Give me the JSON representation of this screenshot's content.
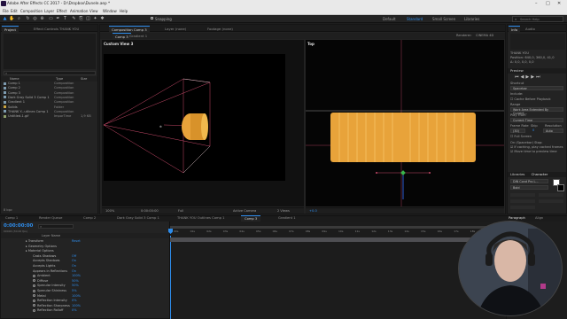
{
  "window": {
    "title": "Adobe After Effects CC 2017 - D:\\Dropbox\\Dunele.aep *"
  },
  "menu": [
    "File",
    "Edit",
    "Composition",
    "Layer",
    "Effect",
    "Animation",
    "View",
    "Window",
    "Help"
  ],
  "toolbar": {
    "snapping_label": "Snapping",
    "workspaces": [
      "Default",
      "Standard",
      "Small Screen",
      "Libraries"
    ],
    "active_workspace": "Standard",
    "search_placeholder": "Search Help"
  },
  "project": {
    "tabs": [
      "Project",
      "Effect Controls THANK YOU"
    ],
    "columns": {
      "name": "Name",
      "type": "Type",
      "size": "Size"
    },
    "items": [
      {
        "name": "Comp 1",
        "type": "Composition",
        "size": "",
        "kind": "comp"
      },
      {
        "name": "Comp 2",
        "type": "Composition",
        "size": "",
        "kind": "comp"
      },
      {
        "name": "Comp 3",
        "type": "Composition",
        "size": "",
        "kind": "comp"
      },
      {
        "name": "Dark Gray Solid 3 Comp 1",
        "type": "Composition",
        "size": "",
        "kind": "comp"
      },
      {
        "name": "Gradient 1",
        "type": "Composition",
        "size": "",
        "kind": "comp"
      },
      {
        "name": "Solids",
        "type": "Folder",
        "size": "",
        "kind": "folder"
      },
      {
        "name": "THANK Y...utlines Comp 1",
        "type": "Composition",
        "size": "",
        "kind": "comp"
      },
      {
        "name": "Untitled-1.gif",
        "type": "ImporTime",
        "size": "1,9 KB",
        "kind": "file"
      }
    ],
    "footer": "8 bpc"
  },
  "composition_panel": {
    "tabs": [
      "Composition Comp 3",
      "Layer (none)",
      "Footage (none)"
    ],
    "subtabs": [
      "Comp 3",
      "Gradient 1"
    ],
    "left_view_label": "Custom View 3",
    "right_view_label": "Top",
    "renderer_label": "Renderer:",
    "renderer_value": "CINEMA 4D",
    "footer": {
      "zoom": "100%",
      "timecode": "0:00:00:00",
      "resolution": "Full",
      "camera": "Active Camera",
      "views": "2 Views",
      "offset": "+0.0"
    }
  },
  "info_panel": {
    "tabs": [
      "Info",
      "Audio"
    ],
    "lines": [
      "THANK YOU",
      "Position: 640,0, 360,0, 41,0",
      "Δ: 0,0, 0,0, 0,0"
    ]
  },
  "preview_panel": {
    "title": "Preview",
    "shortcut_label": "Shortcut",
    "shortcut_value": "Spacebar",
    "include_label": "Include:",
    "cache_label": "Cache Before Playback",
    "range_label": "Range",
    "range_value": "Work Area Extended By Current...",
    "play_from_label": "Play From",
    "play_from_value": "Current Time",
    "frame_rate_label": "Frame Rate",
    "skip_label": "Skip",
    "resolution_label": "Resolution",
    "frame_rate_value": "(30)",
    "skip_value": "0",
    "resolution_value": "Auto",
    "full_screen_label": "Full Screen",
    "on_stop_label": "On (Spacebar) Stop:",
    "if_caching_label": "If caching, play cached frames",
    "move_time_label": "Move time to preview time"
  },
  "libraries_panel": {
    "tabs": [
      "Libraries",
      "Character"
    ],
    "font": "DIN Cond Pro L...",
    "style": "Bold"
  },
  "paragraph_panel": {
    "tabs": [
      "Paragraph",
      "Align"
    ]
  },
  "timeline": {
    "tabs": [
      "Comp 1",
      "Render Queue",
      "Comp 2",
      "Dark Gray Solid 3 Comp 1",
      "THANK YOU Outlines Comp 1",
      "Comp 3",
      "Gradient 1"
    ],
    "active_tab": "Comp 3",
    "timecode": "0:00:00:00",
    "fps": "00000 (30.00 fps)",
    "search_placeholder": "",
    "column_header": "Layer Name",
    "ruler": [
      "00s",
      "01s",
      "02s",
      "03s",
      "04s",
      "05s",
      "06s",
      "07s",
      "08s",
      "09s",
      "10s",
      "11s",
      "12s",
      "13s",
      "14s",
      "15s",
      "16s",
      "17s",
      "18s",
      "19s"
    ],
    "properties": [
      {
        "name": "Transform",
        "value": "Reset",
        "indent": 0,
        "twirl": true
      },
      {
        "name": "Geometry Options",
        "value": "",
        "indent": 0,
        "twirl": true
      },
      {
        "name": "Material Options",
        "value": "",
        "indent": 0,
        "twirl": true
      },
      {
        "name": "Casts Shadows",
        "value": "Off",
        "indent": 1,
        "twirl": false
      },
      {
        "name": "Accepts Shadows",
        "value": "On",
        "indent": 1,
        "twirl": false
      },
      {
        "name": "Accepts Lights",
        "value": "On",
        "indent": 1,
        "twirl": false
      },
      {
        "name": "Appears in Reflections",
        "value": "On",
        "indent": 1,
        "twirl": false
      },
      {
        "name": "Ambient",
        "value": "100%",
        "indent": 1,
        "twirl": false,
        "stopwatch": true
      },
      {
        "name": "Diffuse",
        "value": "50%",
        "indent": 1,
        "twirl": false,
        "stopwatch": true
      },
      {
        "name": "Specular Intensity",
        "value": "50%",
        "indent": 1,
        "twirl": false,
        "stopwatch": true
      },
      {
        "name": "Specular Shininess",
        "value": "5%",
        "indent": 1,
        "twirl": false,
        "stopwatch": true
      },
      {
        "name": "Metal",
        "value": "100%",
        "indent": 1,
        "twirl": false,
        "stopwatch": true
      },
      {
        "name": "Reflection Intensity",
        "value": "0%",
        "indent": 1,
        "twirl": false,
        "stopwatch": true
      },
      {
        "name": "Reflection Sharpness",
        "value": "100%",
        "indent": 1,
        "twirl": false,
        "stopwatch": true
      },
      {
        "name": "Reflection Rolloff",
        "value": "0%",
        "indent": 1,
        "twirl": false,
        "stopwatch": true
      }
    ]
  },
  "colors": {
    "accent": "#2d8ceb",
    "object_orange": "#e8a33a",
    "frustum_pink": "#c84a6a"
  }
}
